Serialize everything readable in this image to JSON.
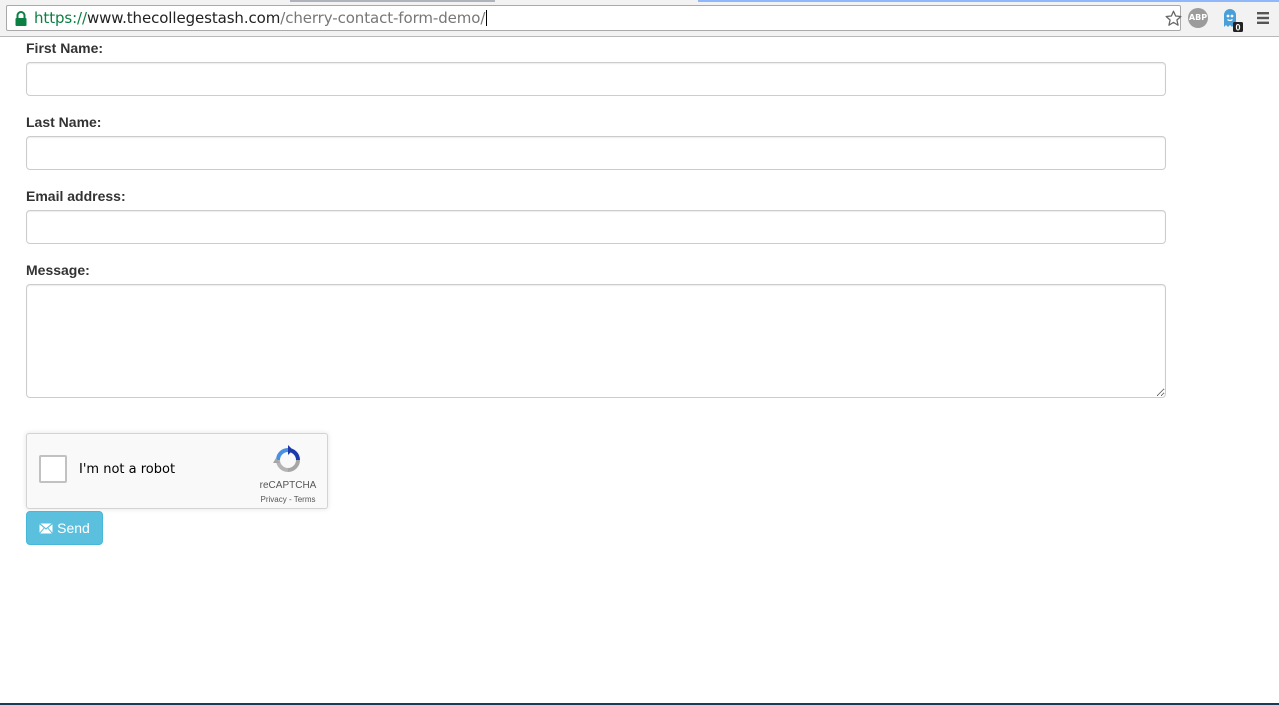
{
  "browser": {
    "url_scheme": "https://",
    "url_host": "www.thecollegestash.com",
    "url_path": "/cherry-contact-form-demo/",
    "extensions": {
      "adblock_label": "ABP",
      "ghostery_badge": "0"
    }
  },
  "form": {
    "first_name_label": "First Name:",
    "first_name_value": "",
    "last_name_label": "Last Name:",
    "last_name_value": "",
    "email_label": "Email address:",
    "email_value": "",
    "message_label": "Message:",
    "message_value": "",
    "send_label": "Send"
  },
  "recaptcha": {
    "label": "I'm not a robot",
    "brand": "reCAPTCHA",
    "links": "Privacy - Terms",
    "checked": false
  },
  "colors": {
    "send_button_bg": "#5bc0de",
    "url_scheme": "#0b8043",
    "input_border": "#cccccc"
  },
  "icons": [
    "lock-icon",
    "star-icon",
    "adblock-icon",
    "ghostery-icon",
    "menu-icon",
    "recaptcha-logo-icon",
    "envelope-icon"
  ]
}
